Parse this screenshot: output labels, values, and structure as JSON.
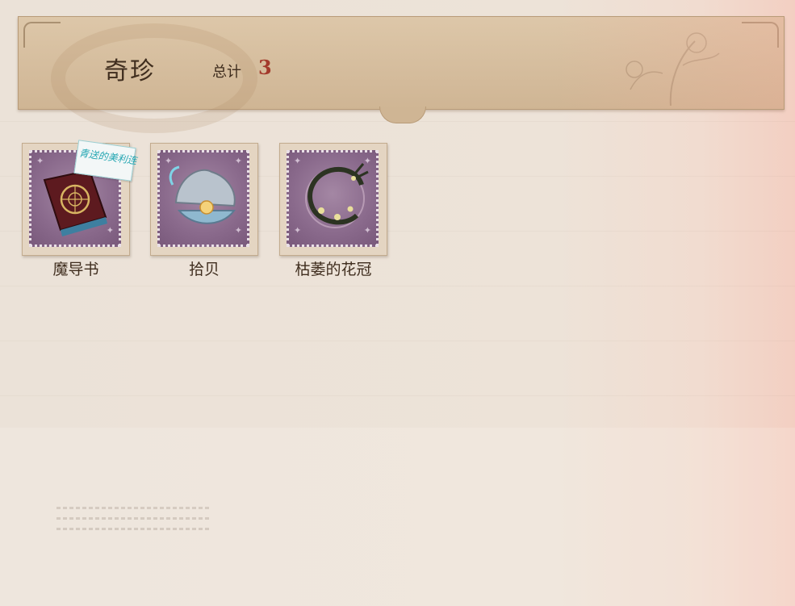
{
  "header": {
    "title": "奇珍",
    "total_label": "总计",
    "total_count": "3"
  },
  "items": [
    {
      "name": "魔导书",
      "icon": "grimoire-book-icon",
      "tag": "青送的美利连"
    },
    {
      "name": "拾贝",
      "icon": "pearl-shell-icon"
    },
    {
      "name": "枯萎的花冠",
      "icon": "withered-wreath-icon"
    }
  ],
  "colors": {
    "header_bg": "#d6bd9e",
    "stamp_purple": "#8a6a8c",
    "count_red": "#a33a2c",
    "text_brown": "#3f2d1e"
  }
}
